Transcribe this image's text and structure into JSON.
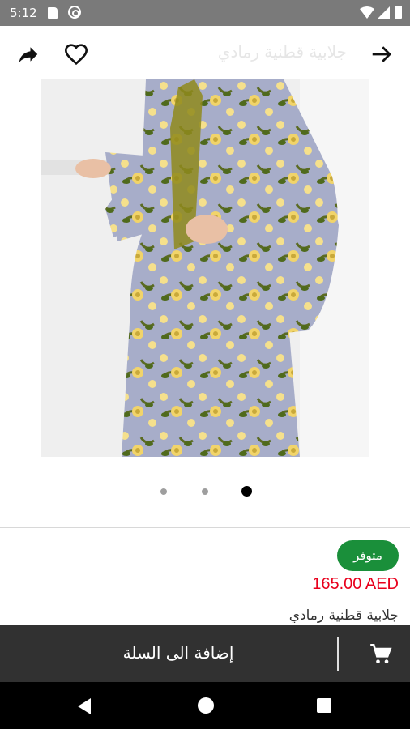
{
  "status_bar": {
    "time": "5:12",
    "icons": [
      "sd-card-icon",
      "at-sign-icon",
      "wifi-icon",
      "signal-icon",
      "battery-icon"
    ]
  },
  "app_bar": {
    "title": "جلابية قطنية رمادي",
    "icons": [
      "share-icon",
      "heart-outline-icon",
      "arrow-right-icon"
    ]
  },
  "gallery": {
    "page_count": 3,
    "current_page": 3,
    "image_icon": "product-photo"
  },
  "product": {
    "availability": "متوفر",
    "price": "165.00 AED",
    "name": "جلابية قطنية رمادي"
  },
  "cart_bar": {
    "label": "إضافة الى السلة",
    "icon": "shopping-cart-icon"
  },
  "nav_bar": {
    "icons": [
      "nav-back-icon",
      "nav-home-icon",
      "nav-recents-icon"
    ]
  },
  "colors": {
    "status_bar": "#7a7a7a",
    "badge": "#1a8f3a",
    "price": "#e8001c",
    "cart_bar": "#313131",
    "nav_bar": "#000000"
  }
}
